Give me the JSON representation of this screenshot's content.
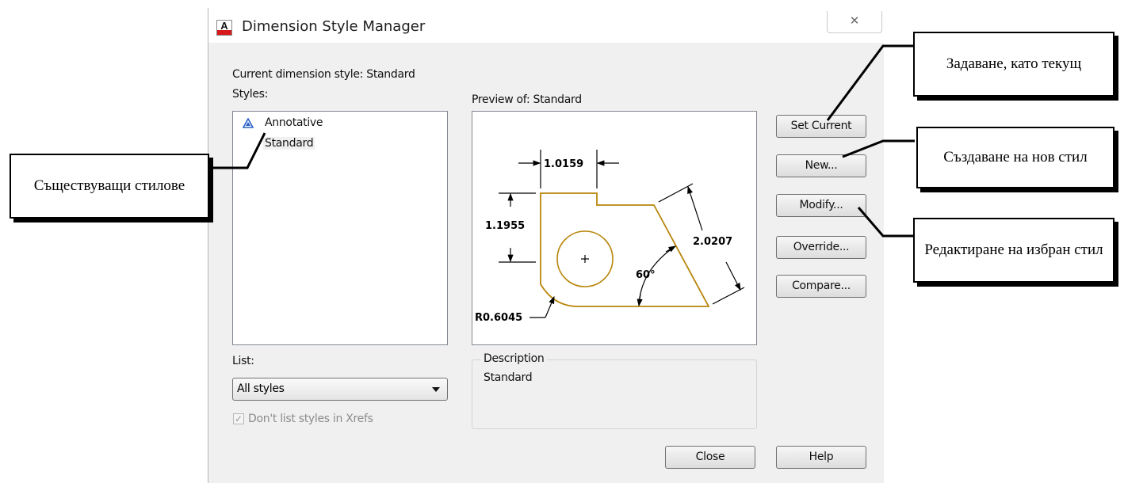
{
  "dialog": {
    "title": "Dimension Style Manager",
    "app_icon_letter": "A",
    "close_glyph": "✕",
    "current_style_label": "Current dimension style: Standard",
    "styles_label": "Styles:",
    "styles": [
      {
        "label": "Annotative",
        "icon": "annotative-icon"
      },
      {
        "label": "Standard",
        "selected": true
      }
    ],
    "preview_label": "Preview of: Standard",
    "preview": {
      "dim_top": "1.0159",
      "dim_left": "1.1955",
      "dim_right": "2.0207",
      "angle": "60°",
      "radius": "R0.6045"
    },
    "list_label": "List:",
    "list_value": "All styles",
    "dont_list_label": "Don't list styles in Xrefs",
    "dont_list_checked": true,
    "description_legend": "Description",
    "description_text": "Standard",
    "buttons": {
      "set_current": "Set Current",
      "new": "New...",
      "modify": "Modify...",
      "override": "Override...",
      "compare": "Compare...",
      "close": "Close",
      "help": "Help"
    }
  },
  "callouts": {
    "existing_styles": "Съществуващи стилове",
    "set_current": "Задаване, като текущ",
    "create_new": "Създаване на нов стил",
    "edit_selected": "Редактиране на избран стил"
  },
  "colors": {
    "drawing_outline": "#b8860b",
    "dialog_bg": "#f0f0f0",
    "app_icon_red": "#d7191c"
  }
}
